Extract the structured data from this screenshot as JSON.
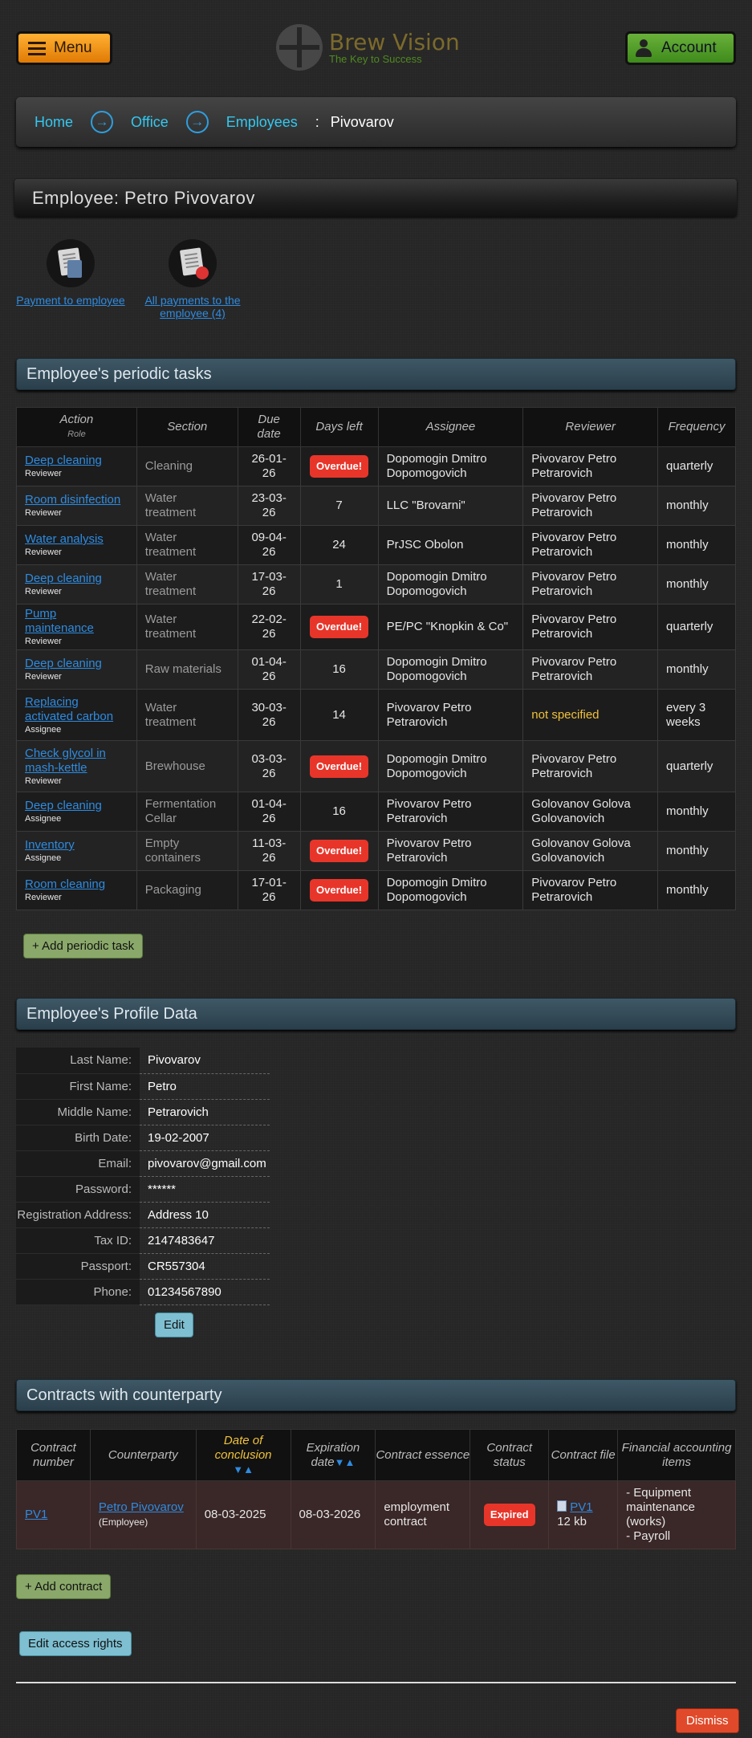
{
  "header": {
    "menu_label": "Menu",
    "brand_name": "Brew Vision",
    "brand_tagline": "The Key to Success",
    "account_label": "Account"
  },
  "breadcrumb": {
    "items": [
      "Home",
      "Office",
      "Employees"
    ],
    "separator": ":",
    "current": "Pivovarov"
  },
  "page_title": "Employee: Petro Pivovarov",
  "quick_actions": [
    {
      "label": "Payment to employee",
      "icon": "calculator-document-icon"
    },
    {
      "label": "All payments to the employee (4)",
      "icon": "payments-list-icon"
    }
  ],
  "tasks": {
    "heading": "Employee's periodic tasks",
    "columns": {
      "action": "Action",
      "role": "Role",
      "section": "Section",
      "due": "Due date",
      "days": "Days left",
      "assignee": "Assignee",
      "reviewer": "Reviewer",
      "frequency": "Frequency"
    },
    "overdue_label": "Overdue!",
    "rows": [
      {
        "action": "Deep cleaning",
        "role": "Reviewer",
        "section": "Cleaning",
        "due": "26-01-26",
        "days": "Overdue!",
        "overdue": true,
        "assignee": "Dopomogin Dmitro Dopomogovich",
        "reviewer": "Pivovarov Petro Petrarovich",
        "frequency": "quarterly"
      },
      {
        "action": "Room disinfection",
        "role": "Reviewer",
        "section": "Water treatment",
        "due": "23-03-26",
        "days": "7",
        "overdue": false,
        "assignee": "LLC \"Brovarni\"",
        "reviewer": "Pivovarov Petro Petrarovich",
        "frequency": "monthly"
      },
      {
        "action": "Water analysis",
        "role": "Reviewer",
        "section": "Water treatment",
        "due": "09-04-26",
        "days": "24",
        "overdue": false,
        "assignee": "PrJSC Obolon",
        "reviewer": "Pivovarov Petro Petrarovich",
        "frequency": "monthly"
      },
      {
        "action": "Deep cleaning",
        "role": "Reviewer",
        "section": "Water treatment",
        "due": "17-03-26",
        "days": "1",
        "overdue": false,
        "assignee": "Dopomogin Dmitro Dopomogovich",
        "reviewer": "Pivovarov Petro Petrarovich",
        "frequency": "monthly"
      },
      {
        "action": "Pump maintenance",
        "role": "Reviewer",
        "section": "Water treatment",
        "due": "22-02-26",
        "days": "Overdue!",
        "overdue": true,
        "assignee": "PE/PC \"Knopkin & Co\"",
        "reviewer": "Pivovarov Petro Petrarovich",
        "frequency": "quarterly"
      },
      {
        "action": "Deep cleaning",
        "role": "Reviewer",
        "section": "Raw materials",
        "due": "01-04-26",
        "days": "16",
        "overdue": false,
        "assignee": "Dopomogin Dmitro Dopomogovich",
        "reviewer": "Pivovarov Petro Petrarovich",
        "frequency": "monthly"
      },
      {
        "action": "Replacing activated carbon",
        "role": "Assignee",
        "section": "Water treatment",
        "due": "30-03-26",
        "days": "14",
        "overdue": false,
        "assignee": "Pivovarov Petro Petrarovich",
        "reviewer": "not specified",
        "reviewer_unset": true,
        "frequency": "every 3 weeks"
      },
      {
        "action": "Check glycol in mash-kettle",
        "role": "Reviewer",
        "section": "Brewhouse",
        "due": "03-03-26",
        "days": "Overdue!",
        "overdue": true,
        "assignee": "Dopomogin Dmitro Dopomogovich",
        "reviewer": "Pivovarov Petro Petrarovich",
        "frequency": "quarterly"
      },
      {
        "action": "Deep cleaning",
        "role": "Assignee",
        "section": "Fermentation Cellar",
        "due": "01-04-26",
        "days": "16",
        "overdue": false,
        "assignee": "Pivovarov Petro Petrarovich",
        "reviewer": "Golovanov Golova Golovanovich",
        "frequency": "monthly"
      },
      {
        "action": "Inventory",
        "role": "Assignee",
        "section": "Empty containers",
        "due": "11-03-26",
        "days": "Overdue!",
        "overdue": true,
        "assignee": "Pivovarov Petro Petrarovich",
        "reviewer": "Golovanov Golova Golovanovich",
        "frequency": "monthly"
      },
      {
        "action": "Room cleaning",
        "role": "Reviewer",
        "section": "Packaging",
        "due": "17-01-26",
        "days": "Overdue!",
        "overdue": true,
        "assignee": "Dopomogin Dmitro Dopomogovich",
        "reviewer": "Pivovarov Petro Petrarovich",
        "frequency": "monthly"
      }
    ],
    "add_label": "+ Add periodic task"
  },
  "profile": {
    "heading": "Employee's Profile Data",
    "fields": [
      {
        "label": "Last Name:",
        "value": "Pivovarov"
      },
      {
        "label": "First Name:",
        "value": "Petro"
      },
      {
        "label": "Middle Name:",
        "value": "Petrarovich"
      },
      {
        "label": "Birth Date:",
        "value": "19-02-2007"
      },
      {
        "label": "Email:",
        "value": "pivovarov@gmail.com"
      },
      {
        "label": "Password:",
        "value": "******"
      },
      {
        "label": "Registration Address:",
        "value": "Address 10"
      },
      {
        "label": "Tax ID:",
        "value": "2147483647"
      },
      {
        "label": "Passport:",
        "value": "CR557304"
      },
      {
        "label": "Phone:",
        "value": "01234567890"
      }
    ],
    "edit_label": "Edit"
  },
  "contracts": {
    "heading": "Contracts with counterparty",
    "columns": {
      "number": "Contract number",
      "counterparty": "Counterparty",
      "concluded": "Date of conclusion",
      "expires": "Expiration date",
      "essence": "Contract essence",
      "status": "Contract status",
      "file": "Contract file",
      "items": "Financial accounting items"
    },
    "sort_glyph": "▼▲",
    "rows": [
      {
        "number": "PV1",
        "counterparty": "Petro Pivovarov",
        "counterparty_note": "(Employee)",
        "concluded": "08-03-2025",
        "expires": "08-03-2026",
        "essence": "employment contract",
        "status": "Expired",
        "file_name": "PV1",
        "file_size": "12 kb",
        "items": "- Equipment maintenance (works)\n- Payroll"
      }
    ],
    "add_label": "+ Add contract"
  },
  "access_label": "Edit access rights",
  "dismiss_label": "Dismiss",
  "colors": {
    "accent_link": "#2e8be0",
    "overdue": "#e8352a",
    "menu_btn": "#f39a1a",
    "account_btn": "#4f9d2a",
    "section_head": "#34505e"
  }
}
